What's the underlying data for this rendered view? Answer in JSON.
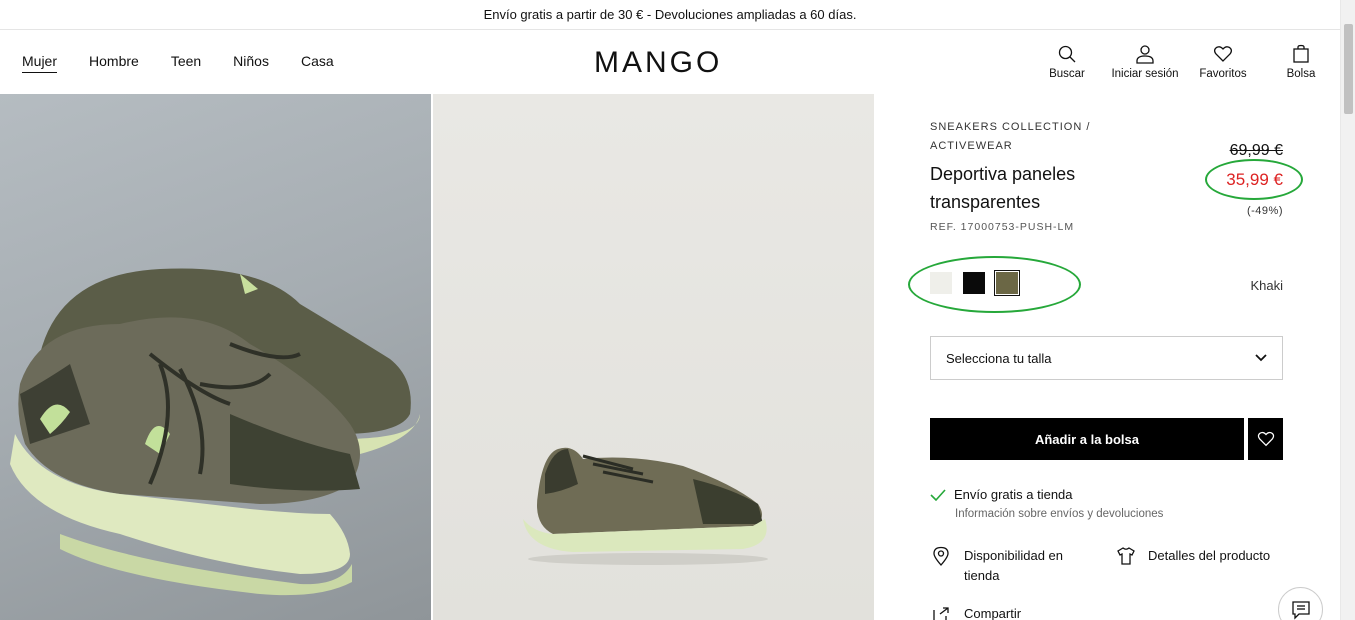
{
  "promo": {
    "text": "Envío gratis a partir de 30 € - Devoluciones ampliadas a 60 días."
  },
  "nav": {
    "items": [
      {
        "label": "Mujer",
        "active": true
      },
      {
        "label": "Hombre"
      },
      {
        "label": "Teen"
      },
      {
        "label": "Niños"
      },
      {
        "label": "Casa"
      }
    ]
  },
  "brand": {
    "logo": "MANGO"
  },
  "header_actions": {
    "search": {
      "label": "Buscar",
      "icon": "search-icon"
    },
    "login": {
      "label": "Iniciar sesión",
      "icon": "user-icon"
    },
    "favorites": {
      "label": "Favoritos",
      "icon": "heart-icon"
    },
    "bag": {
      "label": "Bolsa",
      "icon": "bag-icon"
    }
  },
  "product": {
    "breadcrumb": "SNEAKERS COLLECTION / ACTIVEWEAR",
    "name": "Deportiva paneles transparentes",
    "ref": "REF. 17000753-PUSH-LM",
    "old_price": "69,99 €",
    "price": "35,99 €",
    "discount": "(-49%)",
    "colors": [
      {
        "name": "off-white",
        "hex": "#efefea"
      },
      {
        "name": "black",
        "hex": "#0a0a0a"
      },
      {
        "name": "khaki",
        "hex": "#6b6745",
        "selected": true
      }
    ],
    "selected_color_label": "Khaki",
    "size_placeholder": "Selecciona tu talla",
    "add_to_bag": "Añadir a la bolsa"
  },
  "info": {
    "shipping": "Envío gratis a tienda",
    "shipping_sub": "Información sobre envíos y devoluciones",
    "availability": "Disponibilidad en tienda",
    "details": "Detalles del producto",
    "share": "Compartir"
  },
  "colors": {
    "price_red": "#d22222",
    "highlight_green": "#26a83a",
    "button_black": "#000000"
  }
}
